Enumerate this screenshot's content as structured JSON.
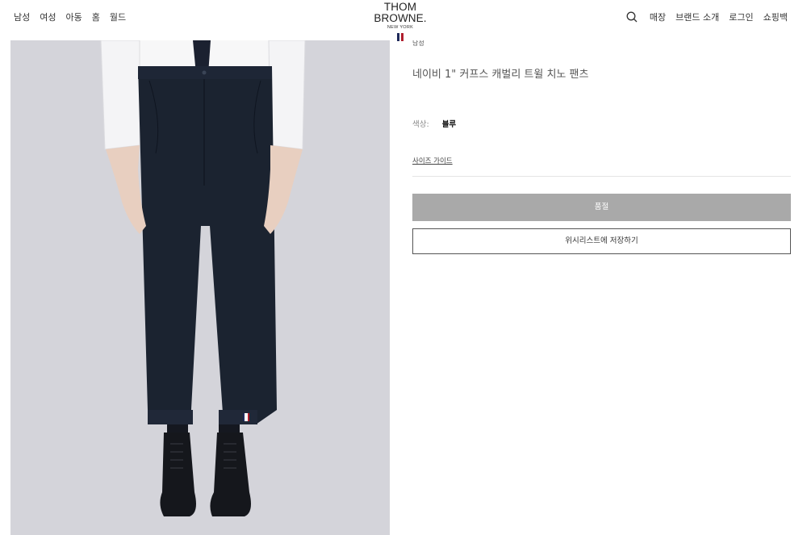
{
  "header": {
    "nav_left": [
      "남성",
      "여성",
      "아동",
      "홈",
      "월드"
    ],
    "logo_main": "THOM BROWNE.",
    "logo_sub": "NEW YORK",
    "nav_right": [
      "매장",
      "브랜드 소개",
      "로그인",
      "쇼핑백"
    ],
    "flag_colors": [
      "#1f2a5a",
      "#ffffff",
      "#b01e2d"
    ]
  },
  "product": {
    "category": "남성",
    "title": "네이비 1\" 커프스 캐벌리 트윌 치노 팬츠",
    "color_label": "색상:",
    "color_value": "블루",
    "size_guide": "사이즈 가이드",
    "soldout_label": "품절",
    "wishlist_label": "위시리스트에 저장하기",
    "pants_color": "#1b2330"
  }
}
